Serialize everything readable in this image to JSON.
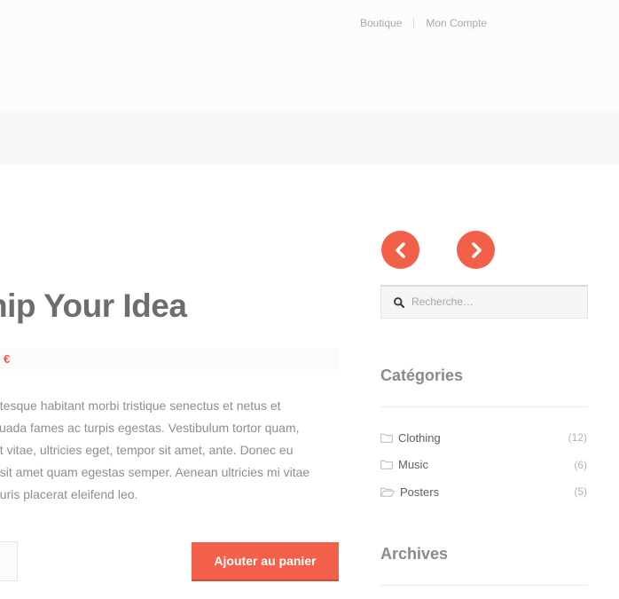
{
  "header": {
    "links": [
      {
        "label": "Boutique"
      },
      {
        "label": "Mon Compte"
      }
    ]
  },
  "product": {
    "title": "hip Your Idea",
    "price": "€",
    "description": [
      "ntesque habitant morbi tristique senectus et netus et",
      "suada fames ac turpis egestas. Vestibulum tortor quam,",
      "at vitae, ultricies eget, tempor sit amet, ante. Donec eu",
      ", sit amet quam egestas semper. Aenean ultricies mi vitae",
      "auris placerat eleifend leo."
    ],
    "add_to_cart": "Ajouter au panier"
  },
  "sidebar": {
    "search_placeholder": "Recherche…",
    "categories_title": "Catégories",
    "categories": [
      {
        "name": "Clothing",
        "count": "(12)",
        "icon": "folder-icon"
      },
      {
        "name": "Music",
        "count": "(6)",
        "icon": "folder-icon"
      },
      {
        "name": "Posters",
        "count": "(5)",
        "icon": "folder-open-icon"
      }
    ],
    "archives_title": "Archives"
  },
  "colors": {
    "accent": "#f26049",
    "price": "#f05a3f",
    "title": "#6d6d6d",
    "text": "#8e8e8e"
  }
}
